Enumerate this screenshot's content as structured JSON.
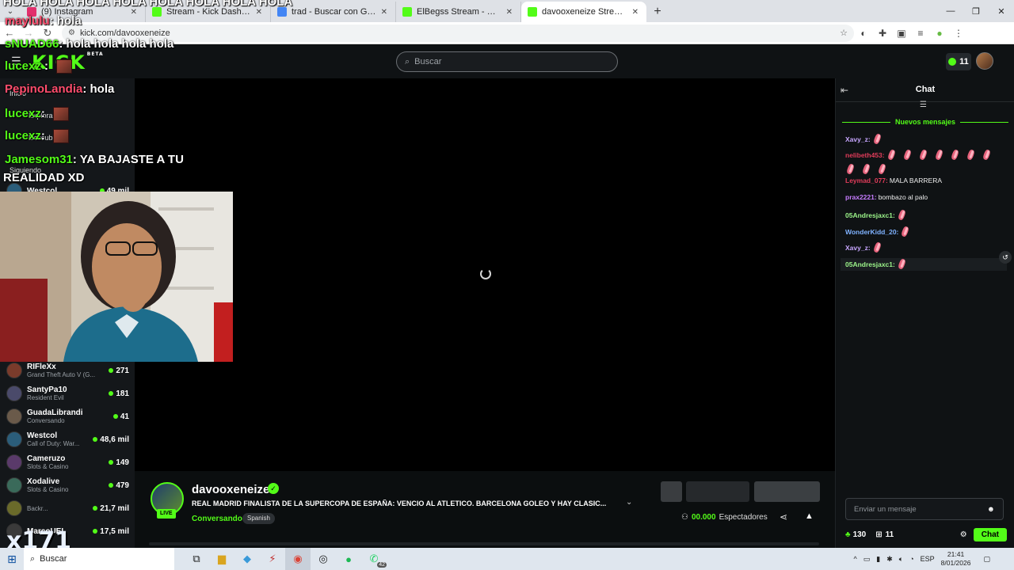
{
  "browser": {
    "tabs": [
      {
        "title": "(9) Instagram",
        "favicon": "instagram-icon",
        "color": "#e1306c"
      },
      {
        "title": "Stream - Kick Dashboard",
        "favicon": "kick-icon",
        "color": "#53fc18"
      },
      {
        "title": "trad - Buscar con Google",
        "favicon": "google-icon",
        "color": "#4285f4"
      },
      {
        "title": "ElBegss Stream - Watch Live on Kick",
        "favicon": "kick-icon",
        "color": "#53fc18"
      },
      {
        "title": "davooxeneize Stream - Watch Live on Kick",
        "favicon": "kick-icon",
        "color": "#53fc18",
        "active": true
      }
    ],
    "url": "kick.com/davooxeneize"
  },
  "header": {
    "logo": "KICK",
    "logo_badge": "BETA",
    "search_placeholder": "Buscar",
    "notifications": "11"
  },
  "sidebar": {
    "nav": [
      "Inicio",
      "Explorar",
      "Descubrir"
    ],
    "following_heading": "Siguiendo",
    "channels": [
      {
        "name": "Westcol",
        "category": "",
        "viewers": "49 mil"
      },
      {
        "name": "RIFleXx",
        "category": "Grand Theft Auto V (G...",
        "viewers": "271"
      },
      {
        "name": "SantyPa10",
        "category": "Resident Evil",
        "viewers": "181"
      },
      {
        "name": "GuadaLibrandi",
        "category": "Conversando",
        "viewers": "41"
      },
      {
        "name": "Westcol",
        "category": "Call of Duty: War...",
        "viewers": "48,6 mil"
      },
      {
        "name": "Cameruzo",
        "category": "Slots & Casino",
        "viewers": "149"
      },
      {
        "name": "Xodalive",
        "category": "Slots & Casino",
        "viewers": "479"
      },
      {
        "name": "",
        "category": "Backr...",
        "viewers": "21,7 mil"
      },
      {
        "name": "MarcoUEL",
        "category": "",
        "viewers": "17,5 mil"
      }
    ]
  },
  "overlay": {
    "messages": [
      {
        "user": "HOLA HOLA HOLA HOLA HOLA HOLA HOLA HOLA",
        "text": "",
        "style": "white"
      },
      {
        "user": "maylulu",
        "text": ": hola",
        "style": "pink"
      },
      {
        "user": "sNUAD66",
        "text": ": hola hola hola hola",
        "style": "green"
      },
      {
        "user": "lucexz",
        "text": " :",
        "style": "green"
      },
      {
        "user": "PepinoLandia",
        "text": ": hola",
        "style": "pink"
      },
      {
        "user": "lucexz",
        "text": ":",
        "style": "green"
      },
      {
        "user": "lucexz",
        "text": ":",
        "style": "green"
      },
      {
        "user": "Jamesom31",
        "text": ": YA BAJASTE A TU",
        "style": "green"
      },
      {
        "user": "",
        "text": "REALIDAD XD",
        "style": "white"
      }
    ],
    "multiplier": "x171"
  },
  "stream": {
    "streamer": "davooxeneize",
    "live_label": "LIVE",
    "title": "REAL MADRID FINALISTA DE LA SUPERCOPA DE ESPAÑA: VENCIO AL ATLETICO. BARCELONA GOLEO Y HAY CLASIC...",
    "category": "Conversando",
    "language": "Spanish",
    "viewers_count": "00.000",
    "viewers_label": "Espectadores"
  },
  "chat": {
    "title": "Chat",
    "new_messages": "Nuevos mensajes",
    "messages": [
      {
        "user": "Xavy_z:",
        "color": "#c7a6ff",
        "text": "",
        "emotes": 1
      },
      {
        "user": "nelibeth453:",
        "color": "#e03c5a",
        "text": "",
        "emotes": 10
      },
      {
        "user": "Leymad_077:",
        "color": "#e03c5a",
        "text": "MALA BARRERA",
        "emotes": 0
      },
      {
        "user": "prax2221:",
        "color": "#c77dff",
        "text": "bombazo al palo",
        "emotes": 0
      },
      {
        "user": "05Andresjaxc1:",
        "color": "#9cf58a",
        "text": "",
        "emotes": 1
      },
      {
        "user": "WonderKidd_20:",
        "color": "#7fb2ff",
        "text": "",
        "emotes": 1
      },
      {
        "user": "Xavy_z:",
        "color": "#c7a6ff",
        "text": "",
        "emotes": 1
      },
      {
        "user": "05Andresjaxc1:",
        "color": "#9cf58a",
        "text": "",
        "emotes": 1
      }
    ],
    "input_placeholder": "Enviar un mensaje",
    "points": "130",
    "subs": "11",
    "send_label": "Chat"
  },
  "taskbar": {
    "search": "Buscar",
    "whatsapp_badge": "42",
    "lang": "ESP",
    "time": "21:41",
    "date": "8/01/2026"
  },
  "colors": {
    "kick_green": "#53fc18",
    "background": "#0b0e0f"
  }
}
